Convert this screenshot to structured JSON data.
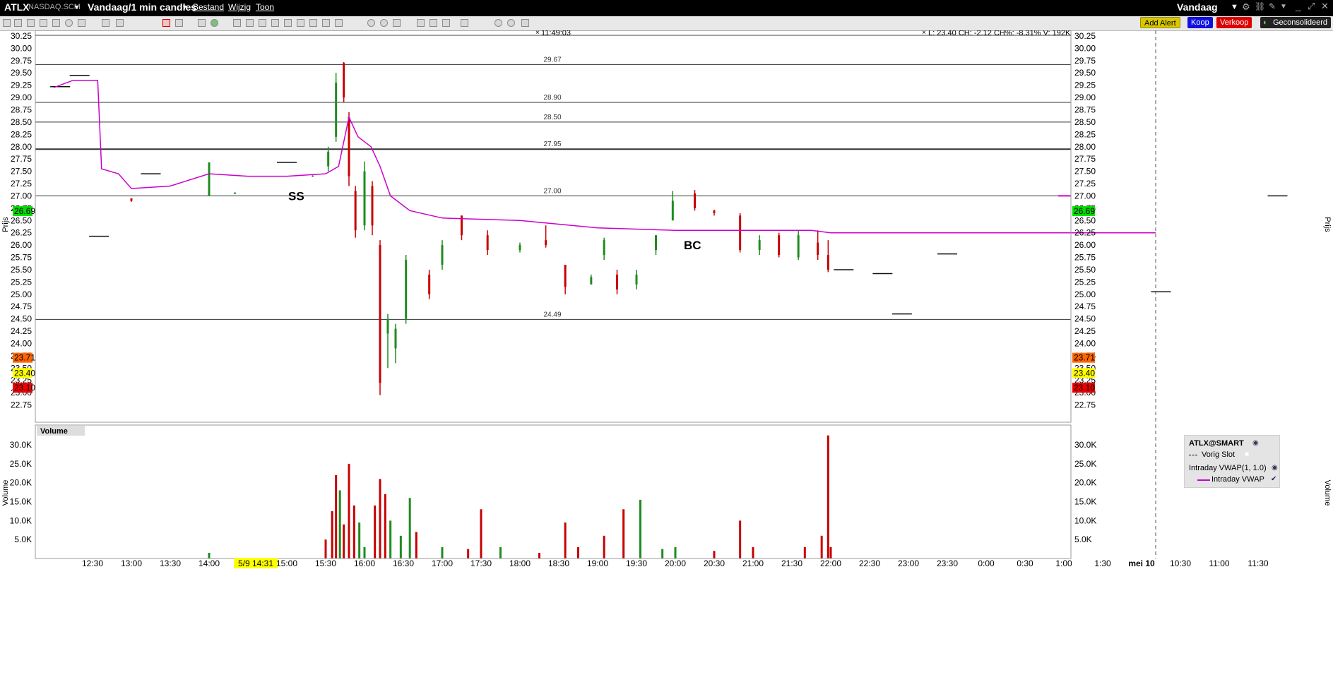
{
  "window": {
    "symbol": "ATLX",
    "exchange": "NASDAQ.SCM",
    "period_label": "Vandaag/1 min candles",
    "menu": [
      "Bestand",
      "Wijzig",
      "Toon"
    ],
    "right_title": "Vandaag"
  },
  "buttons": {
    "add_alert": "Add Alert",
    "buy": "Koop",
    "sell": "Verkoop",
    "consolidated": "Geconsolideerd"
  },
  "colors": {
    "up": "#1e8c1e",
    "down": "#c80000",
    "vwap": "#cc00cc",
    "highlight": "#ffff00",
    "tag_green": "#00dd00",
    "tag_orange": "#ff6600",
    "tag_red": "#ee0000",
    "add_alert": "#ddcc00",
    "buy": "#0000ee",
    "sell": "#dd0000"
  },
  "info_line": "L: 23.40 CH: -2.12 CH%: -8.31% V: 192K",
  "top_label": "11:49:03",
  "annotations": [
    "SS",
    "BC"
  ],
  "chart_data": [
    {
      "type": "candlestick",
      "ylabel": "Prijs",
      "ylim": [
        22.5,
        30.35
      ],
      "yticks": [
        "30.25",
        "30.00",
        "29.75",
        "29.50",
        "29.25",
        "29.00",
        "28.75",
        "28.50",
        "28.25",
        "28.00",
        "27.75",
        "27.50",
        "27.25",
        "27.00",
        "26.75",
        "26.50",
        "26.25",
        "26.00",
        "25.75",
        "25.50",
        "25.25",
        "25.00",
        "24.75",
        "24.50",
        "24.25",
        "24.00",
        "23.75",
        "23.50",
        "23.25",
        "23.00",
        "22.75"
      ],
      "xticks": [
        "12:30",
        "13:00",
        "13:30",
        "14:00",
        "5/9 14:31",
        "15:00",
        "15:30",
        "16:00",
        "16:30",
        "17:00",
        "17:30",
        "18:00",
        "18:30",
        "19:00",
        "19:30",
        "20:00",
        "20:30",
        "21:00",
        "21:30",
        "22:00",
        "22:30",
        "23:00",
        "23:30",
        "0:00",
        "0:30",
        "1:00",
        "1:30",
        "mei 10",
        "10:30",
        "11:00",
        "11:30"
      ],
      "x_start": "5/9 12:00",
      "highlighted_xtick": "5/9 14:31",
      "date_marker": "mei 10",
      "horizontal_levels": [
        29.67,
        28.9,
        28.5,
        27.95,
        27.0,
        24.49
      ],
      "price_tags": [
        {
          "value": "26.69",
          "kind": "green"
        },
        {
          "value": "23.71",
          "kind": "orange"
        },
        {
          "value": "23.40",
          "kind": "yellow"
        },
        {
          "value": "23.10",
          "kind": "red"
        }
      ],
      "candles_sampled": [
        {
          "t": "12:05",
          "o": 29.22,
          "h": 29.22,
          "l": 29.22,
          "c": 29.22
        },
        {
          "t": "12:20",
          "o": 29.45,
          "h": 29.45,
          "l": 29.45,
          "c": 29.45
        },
        {
          "t": "12:35",
          "o": 26.18,
          "h": 26.18,
          "l": 26.18,
          "c": 26.18
        },
        {
          "t": "13:00",
          "o": 26.95,
          "h": 26.95,
          "l": 26.88,
          "c": 26.9
        },
        {
          "t": "13:15",
          "o": 27.45,
          "h": 27.45,
          "l": 27.45,
          "c": 27.45
        },
        {
          "t": "14:00",
          "o": 27.0,
          "h": 27.68,
          "l": 27.0,
          "c": 27.68
        },
        {
          "t": "14:20",
          "o": 27.05,
          "h": 27.08,
          "l": 27.05,
          "c": 27.05
        },
        {
          "t": "15:00",
          "o": 27.68,
          "h": 27.68,
          "l": 27.68,
          "c": 27.68
        },
        {
          "t": "15:20",
          "o": 27.4,
          "h": 27.42,
          "l": 27.4,
          "c": 27.4
        },
        {
          "t": "15:32",
          "o": 27.6,
          "h": 28.0,
          "l": 27.5,
          "c": 27.9
        },
        {
          "t": "15:38",
          "o": 28.2,
          "h": 29.5,
          "l": 28.1,
          "c": 29.3
        },
        {
          "t": "15:44",
          "o": 29.7,
          "h": 29.72,
          "l": 28.9,
          "c": 29.0
        },
        {
          "t": "15:48",
          "o": 28.6,
          "h": 28.7,
          "l": 27.2,
          "c": 27.4
        },
        {
          "t": "15:53",
          "o": 27.1,
          "h": 27.2,
          "l": 26.15,
          "c": 26.3
        },
        {
          "t": "16:00",
          "o": 26.4,
          "h": 27.7,
          "l": 26.3,
          "c": 27.5
        },
        {
          "t": "16:06",
          "o": 27.2,
          "h": 27.3,
          "l": 26.2,
          "c": 26.4
        },
        {
          "t": "16:12",
          "o": 26.0,
          "h": 26.1,
          "l": 22.95,
          "c": 23.2
        },
        {
          "t": "16:18",
          "o": 24.2,
          "h": 24.6,
          "l": 23.5,
          "c": 24.5
        },
        {
          "t": "16:24",
          "o": 23.9,
          "h": 24.4,
          "l": 23.6,
          "c": 24.3
        },
        {
          "t": "16:32",
          "o": 24.5,
          "h": 25.8,
          "l": 24.4,
          "c": 25.7
        },
        {
          "t": "16:50",
          "o": 25.4,
          "h": 25.5,
          "l": 24.9,
          "c": 25.0
        },
        {
          "t": "17:00",
          "o": 25.6,
          "h": 26.1,
          "l": 25.5,
          "c": 26.0
        },
        {
          "t": "17:15",
          "o": 26.6,
          "h": 26.6,
          "l": 26.1,
          "c": 26.2
        },
        {
          "t": "17:35",
          "o": 26.2,
          "h": 26.3,
          "l": 25.8,
          "c": 25.9
        },
        {
          "t": "18:00",
          "o": 25.9,
          "h": 26.05,
          "l": 25.85,
          "c": 26.0
        },
        {
          "t": "18:20",
          "o": 26.1,
          "h": 26.4,
          "l": 25.95,
          "c": 26.0
        },
        {
          "t": "18:35",
          "o": 25.6,
          "h": 25.6,
          "l": 25.0,
          "c": 25.15
        },
        {
          "t": "18:55",
          "o": 25.2,
          "h": 25.4,
          "l": 25.2,
          "c": 25.35
        },
        {
          "t": "19:05",
          "o": 25.8,
          "h": 26.15,
          "l": 25.7,
          "c": 26.1
        },
        {
          "t": "19:15",
          "o": 25.4,
          "h": 25.5,
          "l": 25.0,
          "c": 25.1
        },
        {
          "t": "19:30",
          "o": 25.2,
          "h": 25.5,
          "l": 25.1,
          "c": 25.4
        },
        {
          "t": "19:45",
          "o": 25.9,
          "h": 26.2,
          "l": 25.8,
          "c": 26.2
        },
        {
          "t": "19:58",
          "o": 26.5,
          "h": 27.1,
          "l": 26.5,
          "c": 26.9
        },
        {
          "t": "20:15",
          "o": 27.05,
          "h": 27.12,
          "l": 26.7,
          "c": 26.75
        },
        {
          "t": "20:30",
          "o": 26.7,
          "h": 26.72,
          "l": 26.6,
          "c": 26.65
        },
        {
          "t": "20:50",
          "o": 26.6,
          "h": 26.65,
          "l": 25.85,
          "c": 25.9
        },
        {
          "t": "21:05",
          "o": 25.9,
          "h": 26.2,
          "l": 25.8,
          "c": 26.1
        },
        {
          "t": "21:20",
          "o": 26.2,
          "h": 26.25,
          "l": 25.75,
          "c": 25.8
        },
        {
          "t": "21:35",
          "o": 25.75,
          "h": 26.3,
          "l": 25.7,
          "c": 26.2
        },
        {
          "t": "21:50",
          "o": 26.05,
          "h": 26.3,
          "l": 25.7,
          "c": 25.8
        },
        {
          "t": "21:58",
          "o": 25.8,
          "h": 26.1,
          "l": 25.45,
          "c": 25.5
        },
        {
          "t": "22:10",
          "o": 25.5,
          "h": 25.5,
          "l": 25.5,
          "c": 25.5
        },
        {
          "t": "22:40",
          "o": 25.42,
          "h": 25.42,
          "l": 25.42,
          "c": 25.42
        },
        {
          "t": "22:55",
          "o": 24.6,
          "h": 24.6,
          "l": 24.6,
          "c": 24.6
        },
        {
          "t": "23:30",
          "o": 25.82,
          "h": 25.82,
          "l": 25.82,
          "c": 25.82
        },
        {
          "t": "10:15",
          "o": 25.05,
          "h": 25.05,
          "l": 25.05,
          "c": 25.05
        },
        {
          "t": "11:45",
          "o": 27.0,
          "h": 27.0,
          "l": 27.0,
          "c": 27.0
        }
      ],
      "vwap": [
        {
          "t": "12:00",
          "v": 29.2
        },
        {
          "t": "12:15",
          "v": 29.35
        },
        {
          "t": "12:34",
          "v": 29.35
        },
        {
          "t": "12:37",
          "v": 27.55
        },
        {
          "t": "12:50",
          "v": 27.45
        },
        {
          "t": "13:00",
          "v": 27.15
        },
        {
          "t": "13:30",
          "v": 27.2
        },
        {
          "t": "14:00",
          "v": 27.45
        },
        {
          "t": "14:30",
          "v": 27.4
        },
        {
          "t": "15:00",
          "v": 27.4
        },
        {
          "t": "15:30",
          "v": 27.45
        },
        {
          "t": "15:40",
          "v": 27.6
        },
        {
          "t": "15:48",
          "v": 28.6
        },
        {
          "t": "15:55",
          "v": 28.2
        },
        {
          "t": "16:05",
          "v": 28.0
        },
        {
          "t": "16:12",
          "v": 27.6
        },
        {
          "t": "16:20",
          "v": 27.0
        },
        {
          "t": "16:35",
          "v": 26.7
        },
        {
          "t": "17:00",
          "v": 26.55
        },
        {
          "t": "18:00",
          "v": 26.5
        },
        {
          "t": "19:00",
          "v": 26.35
        },
        {
          "t": "20:00",
          "v": 26.3
        },
        {
          "t": "21:00",
          "v": 26.3
        },
        {
          "t": "21:45",
          "v": 26.3
        },
        {
          "t": "22:00",
          "v": 26.25
        },
        {
          "t": "mei 10",
          "v": 26.25
        }
      ]
    },
    {
      "type": "bar",
      "title": "Volume",
      "ylabel": "Volume",
      "ylim": [
        0,
        33000
      ],
      "yticks": [
        "30.0K",
        "25.0K",
        "20.0K",
        "15.0K",
        "10.0K",
        "5.0K"
      ],
      "bars_sampled": [
        {
          "t": "14:00",
          "v": 1500,
          "dir": "up"
        },
        {
          "t": "15:30",
          "v": 5000,
          "dir": "down"
        },
        {
          "t": "15:35",
          "v": 12500,
          "dir": "down"
        },
        {
          "t": "15:38",
          "v": 22000,
          "dir": "down"
        },
        {
          "t": "15:41",
          "v": 18000,
          "dir": "up"
        },
        {
          "t": "15:44",
          "v": 9000,
          "dir": "down"
        },
        {
          "t": "15:48",
          "v": 25000,
          "dir": "down"
        },
        {
          "t": "15:52",
          "v": 14000,
          "dir": "down"
        },
        {
          "t": "15:56",
          "v": 9500,
          "dir": "up"
        },
        {
          "t": "16:00",
          "v": 3000,
          "dir": "up"
        },
        {
          "t": "16:08",
          "v": 14000,
          "dir": "down"
        },
        {
          "t": "16:12",
          "v": 21000,
          "dir": "down"
        },
        {
          "t": "16:16",
          "v": 17000,
          "dir": "down"
        },
        {
          "t": "16:20",
          "v": 10000,
          "dir": "up"
        },
        {
          "t": "16:28",
          "v": 6000,
          "dir": "up"
        },
        {
          "t": "16:35",
          "v": 16000,
          "dir": "up"
        },
        {
          "t": "16:40",
          "v": 7000,
          "dir": "down"
        },
        {
          "t": "17:00",
          "v": 3000,
          "dir": "up"
        },
        {
          "t": "17:20",
          "v": 2500,
          "dir": "down"
        },
        {
          "t": "17:30",
          "v": 13000,
          "dir": "down"
        },
        {
          "t": "17:45",
          "v": 3000,
          "dir": "up"
        },
        {
          "t": "18:15",
          "v": 1500,
          "dir": "down"
        },
        {
          "t": "18:35",
          "v": 9500,
          "dir": "down"
        },
        {
          "t": "18:45",
          "v": 3000,
          "dir": "down"
        },
        {
          "t": "19:05",
          "v": 6000,
          "dir": "down"
        },
        {
          "t": "19:20",
          "v": 13000,
          "dir": "down"
        },
        {
          "t": "19:33",
          "v": 15500,
          "dir": "up"
        },
        {
          "t": "19:50",
          "v": 2500,
          "dir": "up"
        },
        {
          "t": "20:00",
          "v": 3000,
          "dir": "up"
        },
        {
          "t": "20:30",
          "v": 2000,
          "dir": "down"
        },
        {
          "t": "20:50",
          "v": 10000,
          "dir": "down"
        },
        {
          "t": "21:00",
          "v": 3000,
          "dir": "down"
        },
        {
          "t": "21:40",
          "v": 3000,
          "dir": "down"
        },
        {
          "t": "21:53",
          "v": 6000,
          "dir": "down"
        },
        {
          "t": "21:58",
          "v": 32500,
          "dir": "down"
        },
        {
          "t": "22:00",
          "v": 3000,
          "dir": "down"
        }
      ]
    }
  ],
  "legend": {
    "title": "ATLX@SMART",
    "items": [
      "Vorig Slot",
      "Intraday VWAP(1, 1.0)",
      "Intraday VWAP"
    ]
  }
}
